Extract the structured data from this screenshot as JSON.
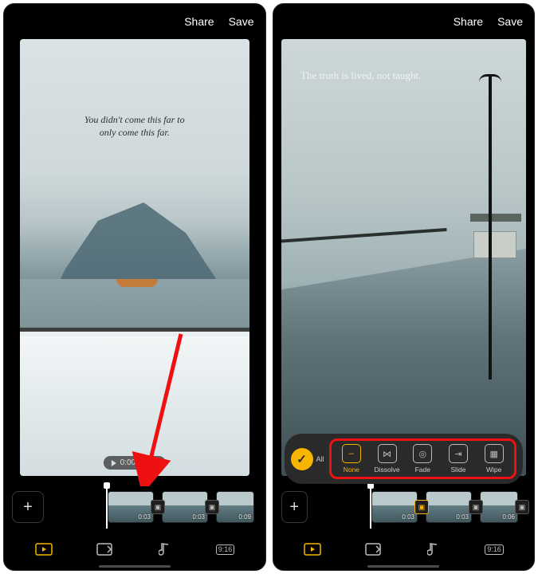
{
  "header": {
    "share": "Share",
    "save": "Save"
  },
  "left": {
    "caption_l1": "You didn't come this far to",
    "caption_l2": "only come this far.",
    "play_time": "0:00 / 0:15",
    "clips": [
      {
        "time": "0:03"
      },
      {
        "time": "0:03"
      },
      {
        "time": "0:09"
      }
    ]
  },
  "right": {
    "caption": "The truth is lived, not taught.",
    "clips": [
      {
        "time": "0:03"
      },
      {
        "time": "0:03"
      },
      {
        "time": "0:06"
      }
    ],
    "transitions": {
      "all_label": "All",
      "options": [
        {
          "id": "none",
          "label": "None",
          "glyph": "–",
          "selected": true
        },
        {
          "id": "dissolve",
          "label": "Dissolve",
          "glyph": "⋈",
          "selected": false
        },
        {
          "id": "fade",
          "label": "Fade",
          "glyph": "◎",
          "selected": false
        },
        {
          "id": "slide",
          "label": "Slide",
          "glyph": "⇥",
          "selected": false
        },
        {
          "id": "wipe",
          "label": "Wipe",
          "glyph": "▦",
          "selected": false
        }
      ]
    }
  },
  "nav": {
    "ratio": "9:16"
  }
}
